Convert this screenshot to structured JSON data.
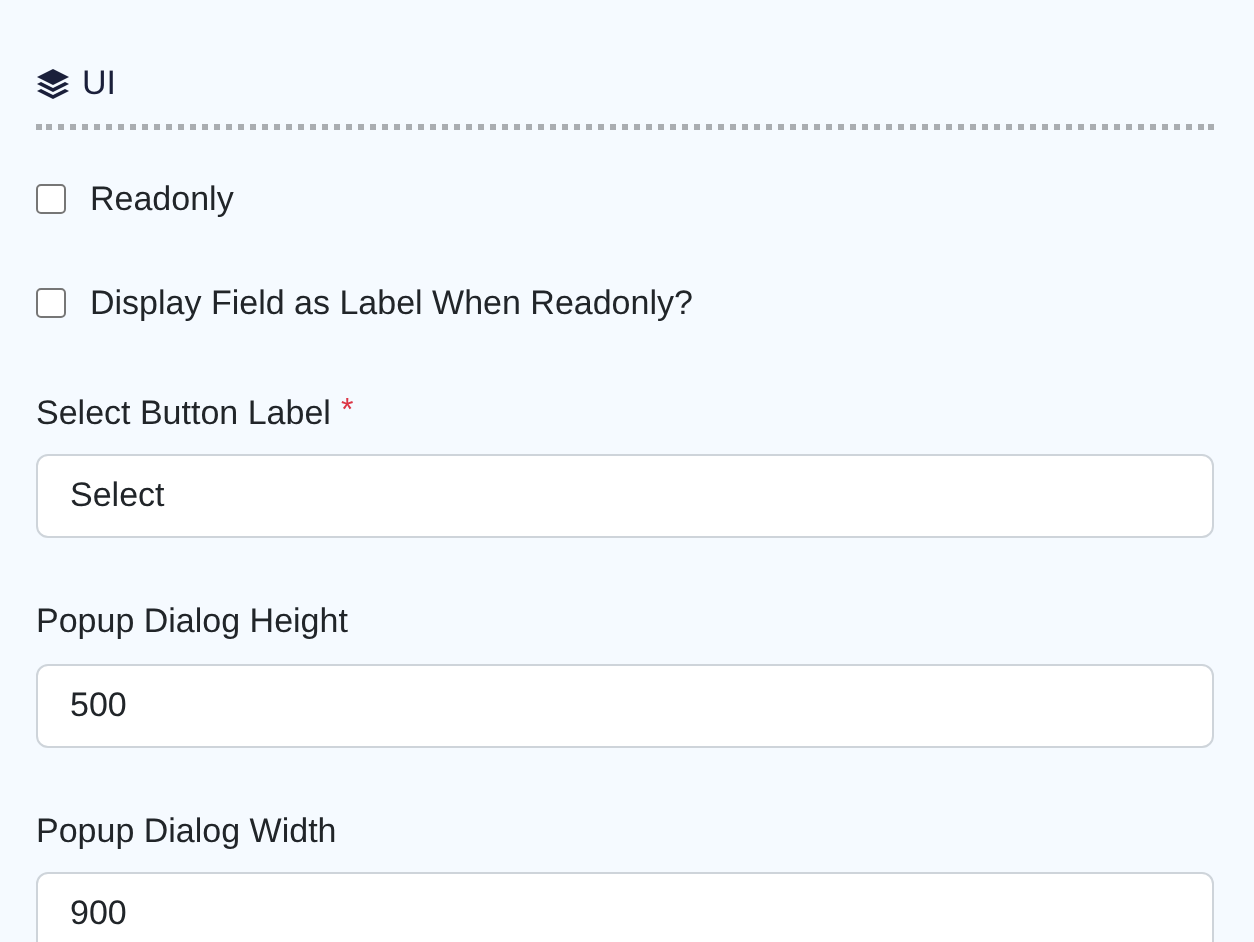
{
  "section": {
    "title": "UI"
  },
  "fields": [
    {
      "kind": "checkbox",
      "label": "Readonly",
      "checked": false
    },
    {
      "kind": "checkbox",
      "label": "Display Field as Label When Readonly?",
      "checked": false
    },
    {
      "kind": "text",
      "label": "Select Button Label",
      "required_mark": "*",
      "value": "Select"
    },
    {
      "kind": "text",
      "label": "Popup Dialog Height",
      "value": "500"
    },
    {
      "kind": "text",
      "label": "Popup Dialog Width",
      "value": "900"
    }
  ]
}
